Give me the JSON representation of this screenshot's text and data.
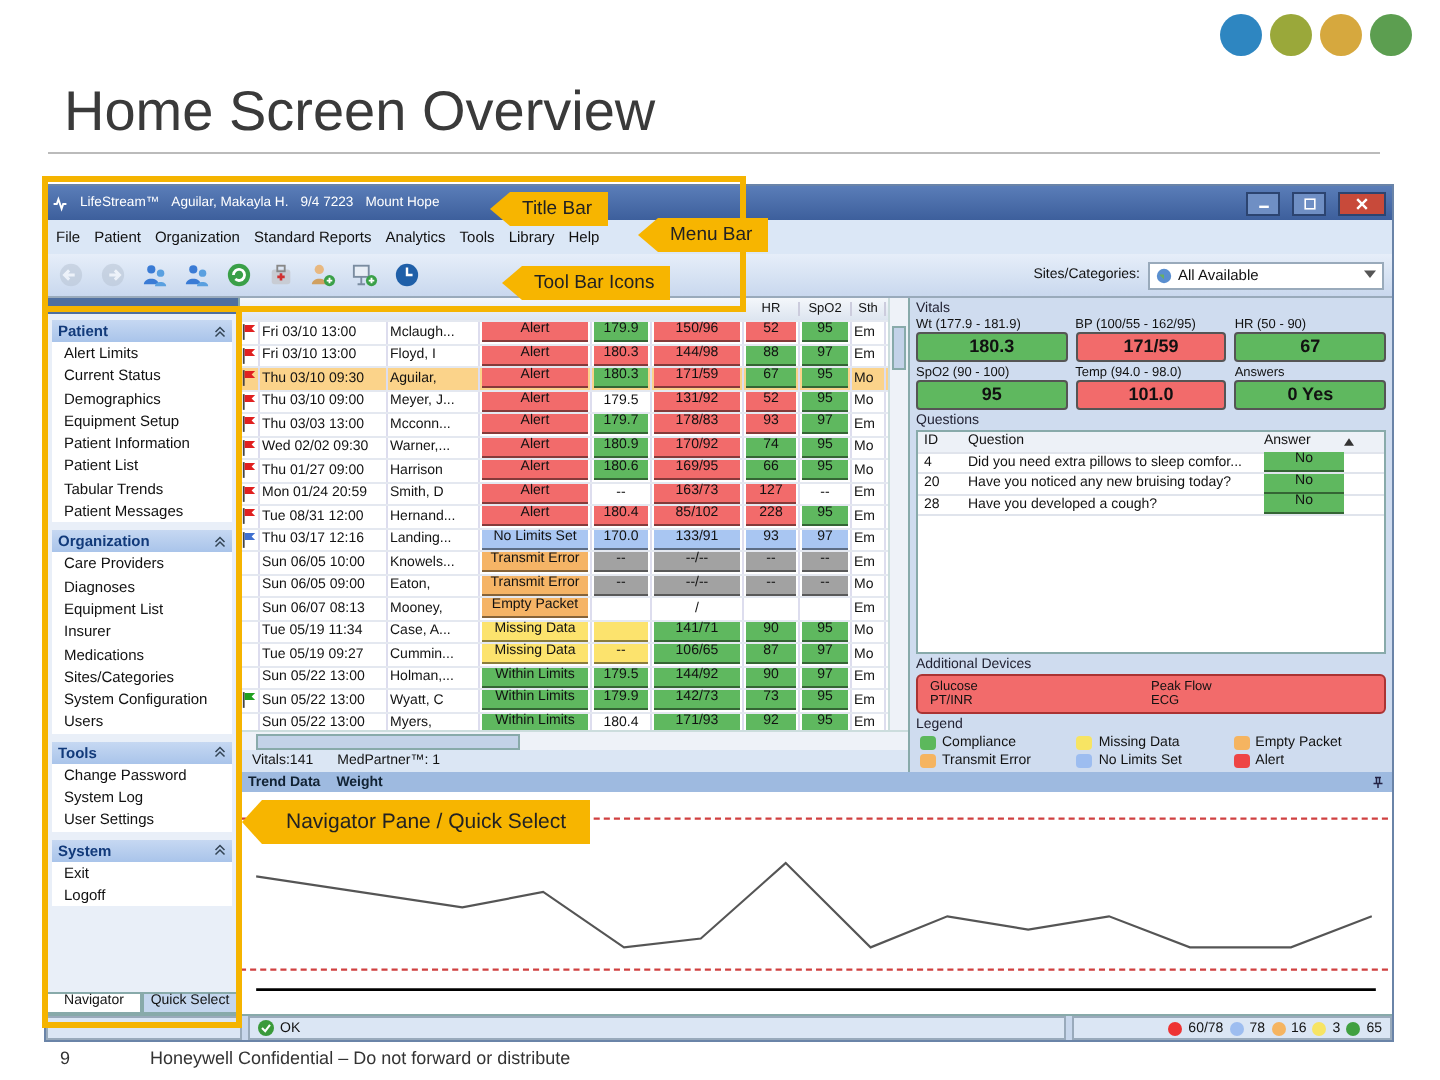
{
  "slide": {
    "title": "Home Screen Overview",
    "page_number": "9",
    "footer": "Honeywell Confidential – Do not forward or distribute"
  },
  "window": {
    "title_parts": [
      "LifeStream™",
      "Aguilar, Makayla H.",
      "9/4 7223",
      "Mount Hope"
    ]
  },
  "menu": [
    "File",
    "Patient",
    "Organization",
    "Standard Reports",
    "Analytics",
    "Tools",
    "Library",
    "Help"
  ],
  "toolbar": {
    "icons": [
      {
        "kind": "back",
        "disabled": true
      },
      {
        "kind": "forward",
        "disabled": true
      },
      {
        "kind": "people",
        "disabled": false
      },
      {
        "kind": "people",
        "disabled": false
      },
      {
        "kind": "refresh",
        "disabled": false
      },
      {
        "kind": "bag",
        "disabled": false
      },
      {
        "kind": "add-user",
        "disabled": false
      },
      {
        "kind": "add-device",
        "disabled": false
      },
      {
        "kind": "clock",
        "disabled": false
      }
    ],
    "sites_label": "Sites/Categories:",
    "sites_value": "All Available"
  },
  "navigator": {
    "sections": [
      {
        "title": "Patient",
        "expanded": true,
        "items": [
          "Alert Limits",
          "Current Status",
          "Demographics",
          "Equipment Setup",
          "Patient Information",
          "Patient List",
          "Tabular Trends",
          "Patient Messages"
        ]
      },
      {
        "title": "Organization",
        "expanded": true,
        "items": [
          "Care Providers",
          "Diagnoses",
          "Equipment List",
          "Insurer",
          "Medications",
          "Sites/Categories",
          "System Configuration",
          "Users"
        ]
      },
      {
        "title": "Tools",
        "expanded": true,
        "items": [
          "Change Password",
          "System Log",
          "User Settings"
        ]
      },
      {
        "title": "System",
        "expanded": true,
        "items": [
          "Exit",
          "Logoff"
        ]
      }
    ],
    "tabs": [
      {
        "label": "Navigator",
        "selected": true
      },
      {
        "label": "Quick Select",
        "selected": false
      }
    ]
  },
  "table": {
    "columns": [
      "",
      "",
      "",
      "",
      "",
      "HR",
      "SpO2",
      "Sth"
    ],
    "rows": [
      {
        "flag": {
          "color": "#e02020"
        },
        "selected": false,
        "cells": [
          {
            "text": "Fri 03/10 13:00"
          },
          {
            "text": "Mclaugh..."
          },
          {
            "text": "Alert",
            "color": "#f26b6b"
          },
          {
            "text": "179.9",
            "color": "#5fb85f"
          },
          {
            "text": "150/96",
            "color": "#f26b6b"
          },
          {
            "text": "52",
            "color": "#f26b6b"
          },
          {
            "text": "95",
            "color": "#5fb85f"
          },
          {
            "text": "Em"
          }
        ]
      },
      {
        "flag": {
          "color": "#e02020"
        },
        "selected": false,
        "cells": [
          {
            "text": "Fri 03/10 13:00"
          },
          {
            "text": "Floyd, I"
          },
          {
            "text": "Alert",
            "color": "#f26b6b"
          },
          {
            "text": "180.3",
            "color": "#f26b6b"
          },
          {
            "text": "144/98",
            "color": "#f26b6b"
          },
          {
            "text": "88",
            "color": "#5fb85f"
          },
          {
            "text": "97",
            "color": "#5fb85f"
          },
          {
            "text": "Em"
          }
        ]
      },
      {
        "flag": {
          "color": "#e02020"
        },
        "selected": true,
        "cells": [
          {
            "text": "Thu 03/10 09:30"
          },
          {
            "text": "Aguilar,"
          },
          {
            "text": "Alert",
            "color": "#f26b6b"
          },
          {
            "text": "180.3",
            "color": "#5fb85f"
          },
          {
            "text": "171/59",
            "color": "#f26b6b"
          },
          {
            "text": "67",
            "color": "#5fb85f"
          },
          {
            "text": "95",
            "color": "#5fb85f"
          },
          {
            "text": "Mo"
          }
        ]
      },
      {
        "flag": {
          "color": "#e02020"
        },
        "selected": false,
        "cells": [
          {
            "text": "Thu 03/10 09:00"
          },
          {
            "text": "Meyer, J..."
          },
          {
            "text": "Alert",
            "color": "#f26b6b"
          },
          {
            "text": "179.5"
          },
          {
            "text": "131/92",
            "color": "#f26b6b"
          },
          {
            "text": "52",
            "color": "#f26b6b"
          },
          {
            "text": "95",
            "color": "#5fb85f"
          },
          {
            "text": "Mo"
          }
        ]
      },
      {
        "flag": {
          "color": "#e02020"
        },
        "selected": false,
        "cells": [
          {
            "text": "Thu 03/03 13:00"
          },
          {
            "text": "Mcconn..."
          },
          {
            "text": "Alert",
            "color": "#f26b6b"
          },
          {
            "text": "179.7",
            "color": "#5fb85f"
          },
          {
            "text": "178/83",
            "color": "#f26b6b"
          },
          {
            "text": "93",
            "color": "#f26b6b"
          },
          {
            "text": "97",
            "color": "#5fb85f"
          },
          {
            "text": "Em"
          }
        ]
      },
      {
        "flag": {
          "color": "#e02020"
        },
        "selected": false,
        "cells": [
          {
            "text": "Wed 02/02 09:30"
          },
          {
            "text": "Warner,..."
          },
          {
            "text": "Alert",
            "color": "#f26b6b"
          },
          {
            "text": "180.9",
            "color": "#5fb85f"
          },
          {
            "text": "170/92",
            "color": "#f26b6b"
          },
          {
            "text": "74",
            "color": "#5fb85f"
          },
          {
            "text": "95",
            "color": "#5fb85f"
          },
          {
            "text": "Mo"
          }
        ]
      },
      {
        "flag": {
          "color": "#e02020"
        },
        "selected": false,
        "cells": [
          {
            "text": "Thu 01/27 09:00"
          },
          {
            "text": "Harrison"
          },
          {
            "text": "Alert",
            "color": "#f26b6b"
          },
          {
            "text": "180.6",
            "color": "#5fb85f"
          },
          {
            "text": "169/95",
            "color": "#f26b6b"
          },
          {
            "text": "66",
            "color": "#5fb85f"
          },
          {
            "text": "95",
            "color": "#5fb85f"
          },
          {
            "text": "Mo"
          }
        ]
      },
      {
        "flag": {
          "color": "#e02020"
        },
        "selected": false,
        "cells": [
          {
            "text": "Mon 01/24 20:59"
          },
          {
            "text": "Smith, D"
          },
          {
            "text": "Alert",
            "color": "#f26b6b"
          },
          {
            "text": "--"
          },
          {
            "text": "163/73",
            "color": "#f26b6b"
          },
          {
            "text": "127",
            "color": "#f26b6b"
          },
          {
            "text": "--"
          },
          {
            "text": "Em"
          }
        ]
      },
      {
        "flag": {
          "color": "#e02020"
        },
        "selected": false,
        "cells": [
          {
            "text": "Tue 08/31 12:00"
          },
          {
            "text": "Hernand..."
          },
          {
            "text": "Alert",
            "color": "#f26b6b"
          },
          {
            "text": "180.4",
            "color": "#f26b6b"
          },
          {
            "text": "85/102",
            "color": "#f26b6b"
          },
          {
            "text": "228",
            "color": "#f26b6b"
          },
          {
            "text": "95",
            "color": "#5fb85f"
          },
          {
            "text": "Em"
          }
        ]
      },
      {
        "flag": {
          "color": "#4070d0"
        },
        "selected": false,
        "cells": [
          {
            "text": "Thu 03/17 12:16"
          },
          {
            "text": "Landing..."
          },
          {
            "text": "No Limits Set",
            "color": "#a9c6f2"
          },
          {
            "text": "170.0",
            "color": "#a9c6f2"
          },
          {
            "text": "133/91",
            "color": "#a9c6f2"
          },
          {
            "text": "93",
            "color": "#a9c6f2"
          },
          {
            "text": "97",
            "color": "#a9c6f2"
          },
          {
            "text": "Em"
          }
        ]
      },
      {
        "selected": false,
        "cells": [
          {
            "text": "Sun 06/05 10:00"
          },
          {
            "text": "Knowels..."
          },
          {
            "text": "Transmit Error",
            "color": "#f5b466"
          },
          {
            "text": "--",
            "color": "#a2a2a2"
          },
          {
            "text": "--/--",
            "color": "#a2a2a2"
          },
          {
            "text": "--",
            "color": "#a2a2a2"
          },
          {
            "text": "--",
            "color": "#a2a2a2"
          },
          {
            "text": "Em"
          }
        ]
      },
      {
        "selected": false,
        "cells": [
          {
            "text": "Sun 06/05 09:00"
          },
          {
            "text": "Eaton,"
          },
          {
            "text": "Transmit Error",
            "color": "#f5b466"
          },
          {
            "text": "--",
            "color": "#a2a2a2"
          },
          {
            "text": "--/--",
            "color": "#a2a2a2"
          },
          {
            "text": "--",
            "color": "#a2a2a2"
          },
          {
            "text": "--",
            "color": "#a2a2a2"
          },
          {
            "text": "Mo"
          }
        ]
      },
      {
        "selected": false,
        "cells": [
          {
            "text": "Sun 06/07 08:13"
          },
          {
            "text": "Mooney,"
          },
          {
            "text": "Empty Packet",
            "color": "#f5b466"
          },
          {},
          {
            "text": "/"
          },
          {},
          {},
          {
            "text": "Em"
          }
        ]
      },
      {
        "selected": false,
        "cells": [
          {
            "text": "Tue 05/19 11:34"
          },
          {
            "text": "Case, A..."
          },
          {
            "text": "Missing Data",
            "color": "#fce36d"
          },
          {
            "color": "#fce36d"
          },
          {
            "text": "141/71",
            "color": "#5fb85f"
          },
          {
            "text": "90",
            "color": "#5fb85f"
          },
          {
            "text": "95",
            "color": "#5fb85f"
          },
          {
            "text": "Mo"
          }
        ]
      },
      {
        "selected": false,
        "cells": [
          {
            "text": "Tue 05/19 09:27"
          },
          {
            "text": "Cummin..."
          },
          {
            "text": "Missing Data",
            "color": "#fce36d"
          },
          {
            "text": "--",
            "color": "#fce36d"
          },
          {
            "text": "106/65",
            "color": "#5fb85f"
          },
          {
            "text": "87",
            "color": "#5fb85f"
          },
          {
            "text": "97",
            "color": "#5fb85f"
          },
          {
            "text": "Mo"
          }
        ]
      },
      {
        "selected": false,
        "cells": [
          {
            "text": "Sun 05/22 13:00"
          },
          {
            "text": "Holman,..."
          },
          {
            "text": "Within Limits",
            "color": "#5fb85f"
          },
          {
            "text": "179.5",
            "color": "#5fb85f"
          },
          {
            "text": "144/92",
            "color": "#5fb85f"
          },
          {
            "text": "90",
            "color": "#5fb85f"
          },
          {
            "text": "97",
            "color": "#5fb85f"
          },
          {
            "text": "Em"
          }
        ]
      },
      {
        "flag": {
          "color": "#20a020"
        },
        "selected": false,
        "cells": [
          {
            "text": "Sun 05/22 13:00"
          },
          {
            "text": "Wyatt, C"
          },
          {
            "text": "Within Limits",
            "color": "#5fb85f"
          },
          {
            "text": "179.9",
            "color": "#5fb85f"
          },
          {
            "text": "142/73",
            "color": "#5fb85f"
          },
          {
            "text": "73",
            "color": "#5fb85f"
          },
          {
            "text": "95",
            "color": "#5fb85f"
          },
          {
            "text": "Em"
          }
        ]
      },
      {
        "selected": false,
        "cells": [
          {
            "text": "Sun 05/22 13:00"
          },
          {
            "text": "Myers,"
          },
          {
            "text": "Within Limits",
            "color": "#5fb85f"
          },
          {
            "text": "180.4"
          },
          {
            "text": "171/93",
            "color": "#5fb85f"
          },
          {
            "text": "92",
            "color": "#5fb85f"
          },
          {
            "text": "95",
            "color": "#5fb85f"
          },
          {
            "text": "Em"
          }
        ]
      }
    ]
  },
  "table_status": [
    "Vitals:141",
    "MedPartner™: 1"
  ],
  "vitals": {
    "title": "Vitals",
    "tiles": [
      {
        "label": "Wt (177.9 - 181.9)",
        "value": "180.3",
        "color": "#5fb85f"
      },
      {
        "label": "BP (100/55 - 162/95)",
        "value": "171/59",
        "color": "#f26b6b"
      },
      {
        "label": "HR (50 - 90)",
        "value": "67",
        "color": "#5fb85f"
      },
      {
        "label": "SpO2 (90 - 100)",
        "value": "95",
        "color": "#5fb85f"
      },
      {
        "label": "Temp (94.0 - 98.0)",
        "value": "101.0",
        "color": "#f26b6b"
      },
      {
        "label": "Answers",
        "value": "0 Yes",
        "color": "#5fb85f"
      }
    ]
  },
  "questions": {
    "title": "Questions",
    "columns": [
      "ID",
      "Question",
      "Answer"
    ],
    "rows": [
      {
        "id": "4",
        "question": "Did you need extra pillows to sleep comfor...",
        "answer": "No"
      },
      {
        "id": "20",
        "question": "Have you noticed any new bruising today?",
        "answer": "No"
      },
      {
        "id": "28",
        "question": "Have you developed a cough?",
        "answer": "No"
      }
    ]
  },
  "additional_devices": {
    "title": "Additional Devices",
    "color": "#f26b6b",
    "items": [
      "Glucose",
      "Peak Flow",
      "PT/INR",
      "ECG"
    ]
  },
  "legend": {
    "title": "Legend",
    "items": [
      {
        "label": "Compliance",
        "color": "#5cb85c"
      },
      {
        "label": "Missing Data",
        "color": "#f7e463"
      },
      {
        "label": "Empty Packet",
        "color": "#f5b460"
      },
      {
        "label": "Transmit Error",
        "color": "#f5b460"
      },
      {
        "label": "No Limits Set",
        "color": "#9dbdf0"
      },
      {
        "label": "Alert",
        "color": "#ee4444"
      }
    ]
  },
  "trend": {
    "tabs": [
      "Trend Data",
      "Weight"
    ]
  },
  "status_bar": {
    "status": "OK",
    "counts": [
      {
        "value": "60/78",
        "color": "#ee3333"
      },
      {
        "value": "78",
        "color": "#9dbdf0"
      },
      {
        "value": "16",
        "color": "#f5b460"
      },
      {
        "value": "3",
        "color": "#f7e463"
      },
      {
        "value": "65",
        "color": "#40a040"
      }
    ]
  },
  "callouts": [
    "Title Bar",
    "Menu Bar",
    "Tool Bar Icons",
    "Navigator Pane / Quick Select"
  ]
}
